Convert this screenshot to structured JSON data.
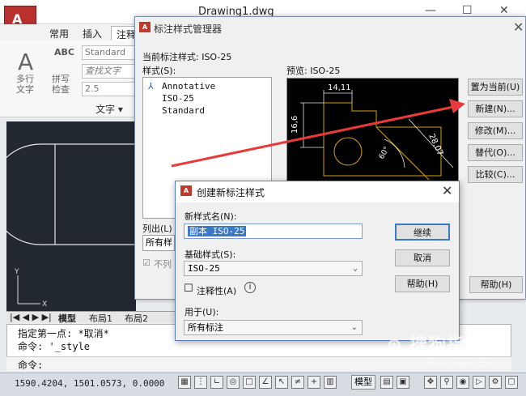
{
  "acad": {
    "doc_title": "Drawing1.dwg",
    "ribbon_tabs": [
      "常用",
      "插入",
      "注释"
    ],
    "ribbon": {
      "multiline_text_label": "多行\n文字",
      "spell_check_label": "拼写\n检查",
      "abc_label": "ABC",
      "text_style_value": "Standard",
      "find_text_placeholder": "查找文字",
      "text_height_value": "2.5",
      "panel_label": "文字 ▾"
    },
    "layout_tabs": [
      "模型",
      "布局1",
      "布局2"
    ],
    "command_lines": [
      "指定第一点: *取消*",
      "命令: '_style",
      "命令:"
    ],
    "coords": "1590.4204, 1501.0573, 0.0000",
    "status_model_label": "模型"
  },
  "dsm": {
    "title": "标注样式管理器",
    "current_style_label": "当前标注样式: ISO-25",
    "styles_label": "样式(S):",
    "preview_label": "预览: ISO-25",
    "styles": [
      "Annotative",
      "ISO-25",
      "Standard"
    ],
    "list_label": "列出(L)",
    "list_value": "所有样",
    "dont_list_label": "不列",
    "buttons": {
      "set_current": "置为当前(U)",
      "new": "新建(N)...",
      "modify": "修改(M)...",
      "override": "替代(O)...",
      "compare": "比较(C)...",
      "help": "帮助(H)"
    },
    "preview_dims": {
      "top": "14,11",
      "left": "16,6",
      "right": "28,07",
      "angle": "60°"
    }
  },
  "cns": {
    "title": "创建新标注样式",
    "new_name_label": "新样式名(N):",
    "new_name_value": "副本 ISO-25",
    "base_style_label": "基础样式(S):",
    "base_style_value": "ISO-25",
    "annotative_label": "注释性(A)",
    "use_for_label": "用于(U):",
    "use_for_value": "所有标注",
    "buttons": {
      "continue": "继续",
      "cancel": "取消",
      "help": "帮助(H)"
    }
  },
  "watermark": {
    "text": "搜狗指南",
    "sub": "zhinan.sogou.com"
  },
  "colors": {
    "accent_red": "#e83a3a",
    "cad_bg": "#212830",
    "selection": "#3a78c8"
  }
}
